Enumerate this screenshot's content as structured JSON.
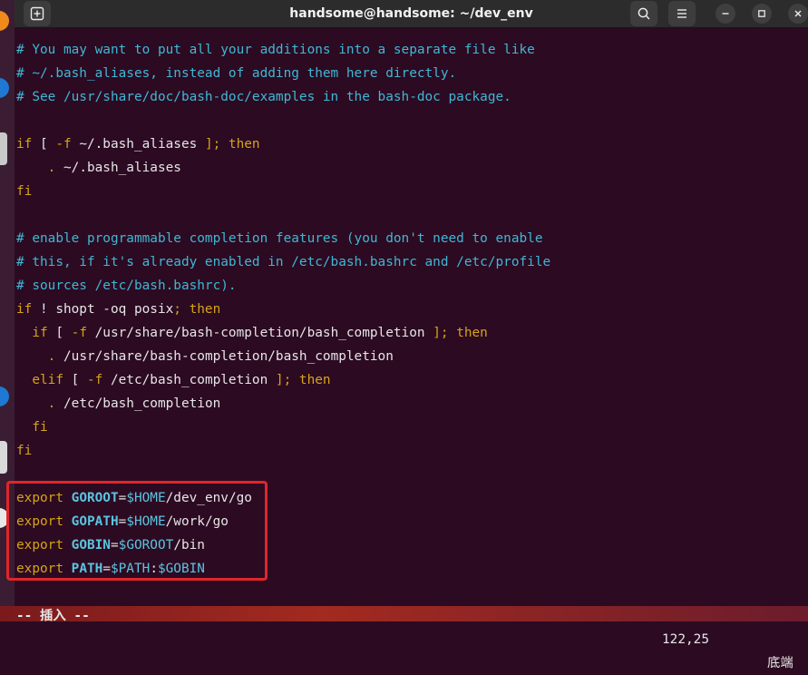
{
  "window": {
    "title": "handsome@handsome: ~/dev_env"
  },
  "icons": {
    "new_tab": "plus-in-square",
    "search": "magnifier",
    "menu": "hamburger",
    "minimize": "dash",
    "maximize": "square",
    "close": "x"
  },
  "editor": {
    "lines": [
      [
        {
          "t": "# You may want to put all your additions into a separate file like",
          "c": "c"
        }
      ],
      [
        {
          "t": "# ~/.bash_aliases, instead of adding them here directly.",
          "c": "c"
        }
      ],
      [
        {
          "t": "# See /usr/share/doc/bash-doc/examples in the bash-doc package.",
          "c": "c"
        }
      ],
      [],
      [
        {
          "t": "if",
          "c": "k"
        },
        {
          "t": " [ ",
          "c": "w"
        },
        {
          "t": "-f",
          "c": "k"
        },
        {
          "t": " ~/.bash_aliases ",
          "c": "w"
        },
        {
          "t": "]; then",
          "c": "k"
        }
      ],
      [
        {
          "t": "    ",
          "c": "w"
        },
        {
          "t": ".",
          "c": "k"
        },
        {
          "t": " ~/.bash_aliases",
          "c": "w"
        }
      ],
      [
        {
          "t": "fi",
          "c": "k"
        }
      ],
      [],
      [
        {
          "t": "# enable programmable completion features (you don't need to enable",
          "c": "c"
        }
      ],
      [
        {
          "t": "# this, if it's already enabled in /etc/bash.bashrc and /etc/profile",
          "c": "c"
        }
      ],
      [
        {
          "t": "# sources /etc/bash.bashrc).",
          "c": "c"
        }
      ],
      [
        {
          "t": "if",
          "c": "k"
        },
        {
          "t": " ! shopt -oq posix",
          "c": "w"
        },
        {
          "t": "; then",
          "c": "k"
        }
      ],
      [
        {
          "t": "  ",
          "c": "w"
        },
        {
          "t": "if",
          "c": "k"
        },
        {
          "t": " [ ",
          "c": "w"
        },
        {
          "t": "-f",
          "c": "k"
        },
        {
          "t": " /usr/share/bash-completion/bash_completion ",
          "c": "w"
        },
        {
          "t": "]; then",
          "c": "k"
        }
      ],
      [
        {
          "t": "    ",
          "c": "w"
        },
        {
          "t": ".",
          "c": "k"
        },
        {
          "t": " /usr/share/bash-completion/bash_completion",
          "c": "w"
        }
      ],
      [
        {
          "t": "  ",
          "c": "w"
        },
        {
          "t": "elif",
          "c": "k"
        },
        {
          "t": " [ ",
          "c": "w"
        },
        {
          "t": "-f",
          "c": "k"
        },
        {
          "t": " /etc/bash_completion ",
          "c": "w"
        },
        {
          "t": "]; then",
          "c": "k"
        }
      ],
      [
        {
          "t": "    ",
          "c": "w"
        },
        {
          "t": ".",
          "c": "k"
        },
        {
          "t": " /etc/bash_completion",
          "c": "w"
        }
      ],
      [
        {
          "t": "  ",
          "c": "w"
        },
        {
          "t": "fi",
          "c": "k"
        }
      ],
      [
        {
          "t": "fi",
          "c": "k"
        }
      ],
      [],
      [
        {
          "t": "export ",
          "c": "k"
        },
        {
          "t": "GOROOT",
          "c": "v"
        },
        {
          "t": "=",
          "c": "w"
        },
        {
          "t": "$HOME",
          "c": "d"
        },
        {
          "t": "/dev_env/go",
          "c": "w"
        }
      ],
      [
        {
          "t": "export ",
          "c": "k"
        },
        {
          "t": "GOPATH",
          "c": "v"
        },
        {
          "t": "=",
          "c": "w"
        },
        {
          "t": "$HOME",
          "c": "d"
        },
        {
          "t": "/work/go",
          "c": "w"
        }
      ],
      [
        {
          "t": "export ",
          "c": "k"
        },
        {
          "t": "GOBIN",
          "c": "v"
        },
        {
          "t": "=",
          "c": "w"
        },
        {
          "t": "$GOROOT",
          "c": "d"
        },
        {
          "t": "/bin",
          "c": "w"
        }
      ],
      [
        {
          "t": "export ",
          "c": "k"
        },
        {
          "t": "PATH",
          "c": "v"
        },
        {
          "t": "=",
          "c": "w"
        },
        {
          "t": "$PATH",
          "c": "d"
        },
        {
          "t": ":",
          "c": "w"
        },
        {
          "t": "$GOBIN",
          "c": "d"
        }
      ]
    ]
  },
  "status": {
    "mode": "-- 插入 --",
    "position": "122,25",
    "scroll": "底端"
  },
  "colors": {
    "background": "#2c0a22",
    "comment": "#3fb8d4",
    "keyword": "#d6a417",
    "text": "#e6e6e6",
    "highlight_box": "#e0262a"
  }
}
